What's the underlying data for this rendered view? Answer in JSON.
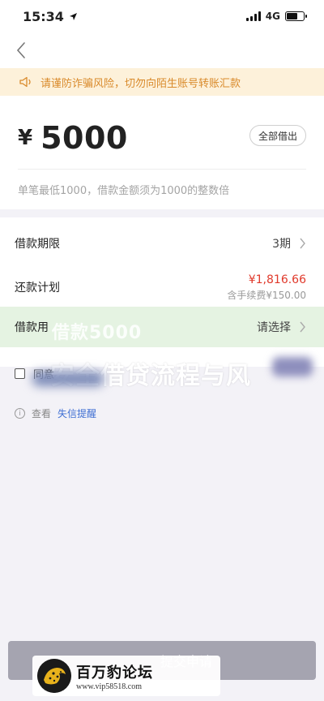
{
  "status_bar": {
    "time": "15:34",
    "network": "4G"
  },
  "warning": {
    "text": "请谨防诈骗风险，切勿向陌生账号转账汇款",
    "icon": "speaker-icon"
  },
  "loan": {
    "currency": "¥",
    "amount": "5000",
    "borrow_all_label": "全部借出",
    "hint": "单笔最低1000，借款金额须为1000的整数倍"
  },
  "form": {
    "term_label": "借款期限",
    "term_value": "3期",
    "plan_label": "还款计划",
    "plan_amount": "¥1,816.66",
    "plan_fee": "含手续费¥150.00",
    "purpose_label": "借款用",
    "purpose_value": "请选择"
  },
  "agreement": {
    "label": "同意"
  },
  "info": {
    "prefix": "查看",
    "link": "失信提醒"
  },
  "overlay": {
    "line1": "借款5000",
    "line2": "安全借贷流程与风"
  },
  "submit": {
    "label": "提交申请"
  },
  "watermark": {
    "name": "百万豹论坛",
    "url": "www.vip58518.com"
  },
  "colors": {
    "accent_red": "#e0392b",
    "warning_bg": "#fdf1da",
    "warning_text": "#d98a2b",
    "link": "#3f6fd3",
    "button_bg": "#a5a4b0"
  }
}
